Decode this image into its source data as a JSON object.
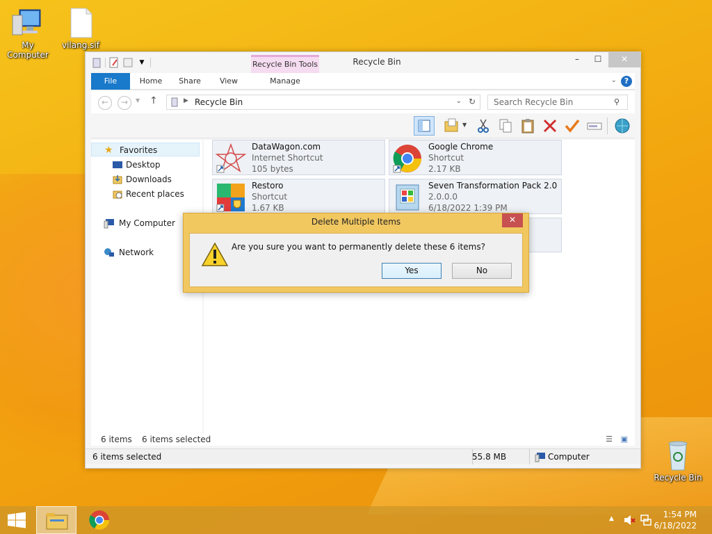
{
  "desktop": {
    "icons": [
      {
        "label": "My Computer"
      },
      {
        "label": "vilang.sif"
      },
      {
        "label": "Recycle Bin"
      }
    ]
  },
  "window": {
    "title": "Recycle Bin",
    "context_tab": "Recycle Bin Tools",
    "ribbon_tabs": [
      "File",
      "Home",
      "Share",
      "View",
      "Manage"
    ],
    "address": "Recycle Bin",
    "search_placeholder": "Search Recycle Bin",
    "nav": {
      "favorites": "Favorites",
      "desktop": "Desktop",
      "downloads": "Downloads",
      "recent": "Recent places",
      "computer": "My Computer",
      "network": "Network"
    },
    "items": [
      {
        "name": "DataWagon.com",
        "type": "Internet Shortcut",
        "detail": "105 bytes"
      },
      {
        "name": "Google Chrome",
        "type": "Shortcut",
        "detail": "2.17 KB"
      },
      {
        "name": "Restoro",
        "type": "Shortcut",
        "detail": "1.67 KB"
      },
      {
        "name": "Seven Transformation Pack 2.0",
        "type": "2.0.0.0",
        "detail": "6/18/2022 1:39 PM"
      }
    ],
    "status": {
      "count": "6 items",
      "selected": "6 items selected",
      "bottom_selected": "6 items selected",
      "size": "55.8 MB",
      "location": "Computer"
    }
  },
  "dialog": {
    "title": "Delete Multiple Items",
    "close": "✕",
    "message": "Are you sure you want to permanently delete these 6 items?",
    "yes": "Yes",
    "no": "No"
  },
  "taskbar": {
    "time": "1:54 PM",
    "date": "6/18/2022"
  },
  "colors": {
    "ribbon_file": "#1979ca",
    "context_tab": "#f5dcf0",
    "dialog_frame": "#f1c760",
    "dialog_close": "#c75050"
  }
}
